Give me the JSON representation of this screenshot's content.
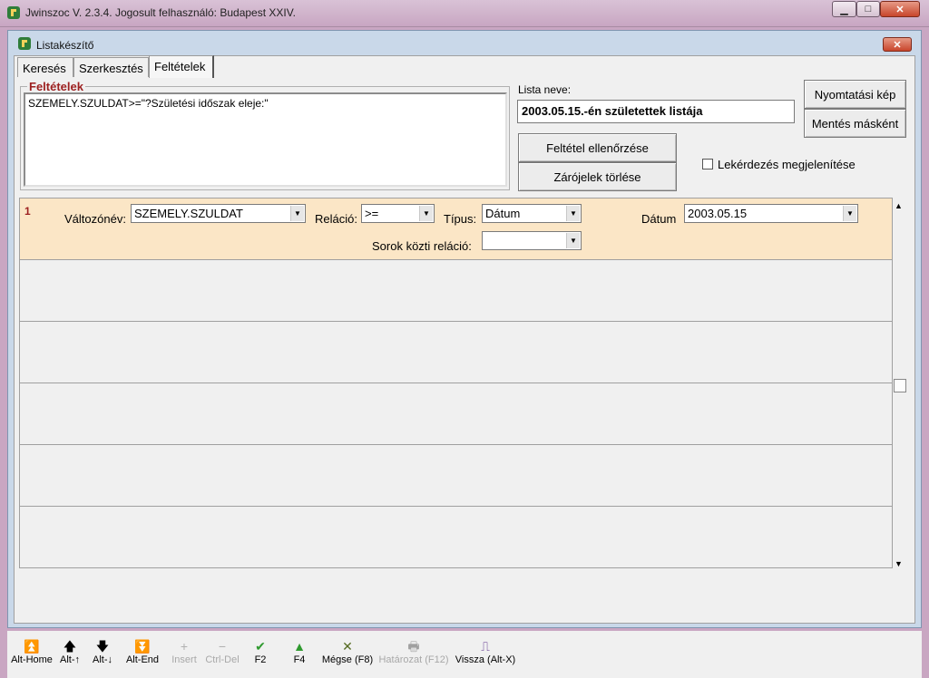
{
  "app_title": "Jwinszoc V. 2.3.4.  Jogosult felhasználó: Budapest XXIV.",
  "window_buttons": {
    "minimize": "▁",
    "maximize": "□",
    "close": "✕"
  },
  "dialog": {
    "title": "Listakészítő",
    "close": "✕"
  },
  "tabs": [
    {
      "label": "Keresés",
      "active": false
    },
    {
      "label": "Szerkesztés",
      "active": false
    },
    {
      "label": "Feltételek",
      "active": true
    }
  ],
  "conditions": {
    "legend": "Feltételek",
    "text": "SZEMELY.SZULDAT>=\"?Születési időszak eleje:\""
  },
  "list_name": {
    "label": "Lista neve:",
    "value": "2003.05.15.-én születettek listája"
  },
  "buttons": {
    "print_preview": "Nyomtatási kép",
    "save_as": "Mentés másként",
    "check_condition": "Feltétel ellenőrzése",
    "delete_parens": "Zárójelek törlése"
  },
  "show_query": {
    "label": "Lekérdezés megjelenítése",
    "checked": false
  },
  "row": {
    "number": "1",
    "variable_label": "Változónév:",
    "variable_value": "SZEMELY.SZULDAT",
    "relation_label": "Reláció:",
    "relation_value": ">=",
    "type_label": "Típus:",
    "type_value": "Dátum",
    "date_label": "Dátum",
    "date_value": "2003.05.15",
    "row_relation_label": "Sorok közti reláció:",
    "row_relation_value": ""
  },
  "scroll": {
    "up": "▲",
    "down": "▼"
  },
  "toolbar": [
    {
      "label": "Alt-Home",
      "icon": "⏫",
      "icon_name": "first-record-icon",
      "enabled": true
    },
    {
      "label": "Alt-↑",
      "icon": "🡅",
      "icon_name": "prev-record-icon",
      "enabled": true
    },
    {
      "label": "Alt-↓",
      "icon": "🡇",
      "icon_name": "next-record-icon",
      "enabled": true
    },
    {
      "label": "Alt-End",
      "icon": "⏬",
      "icon_name": "last-record-icon",
      "enabled": true
    },
    {
      "label": "Insert",
      "icon": "+",
      "icon_name": "insert-icon",
      "enabled": false
    },
    {
      "label": "Ctrl-Del",
      "icon": "−",
      "icon_name": "delete-icon",
      "enabled": false
    },
    {
      "label": "F2",
      "icon": "✔",
      "icon_name": "save-check-icon",
      "enabled": true
    },
    {
      "label": "F4",
      "icon": "▲",
      "icon_name": "green-up-icon",
      "enabled": true
    },
    {
      "label": "Mégse (F8)",
      "icon": "✕",
      "icon_name": "cancel-icon",
      "enabled": true
    },
    {
      "label": "Határozat (F12)",
      "icon": "🖶",
      "icon_name": "print-decision-icon",
      "enabled": false
    },
    {
      "label": "Vissza (Alt-X)",
      "icon": "⎍",
      "icon_name": "exit-door-icon",
      "enabled": true
    }
  ],
  "colors": {
    "legend_red": "#9c1f1f",
    "row_bg": "#fbe6c6",
    "check_green": "#2f9a2f"
  }
}
